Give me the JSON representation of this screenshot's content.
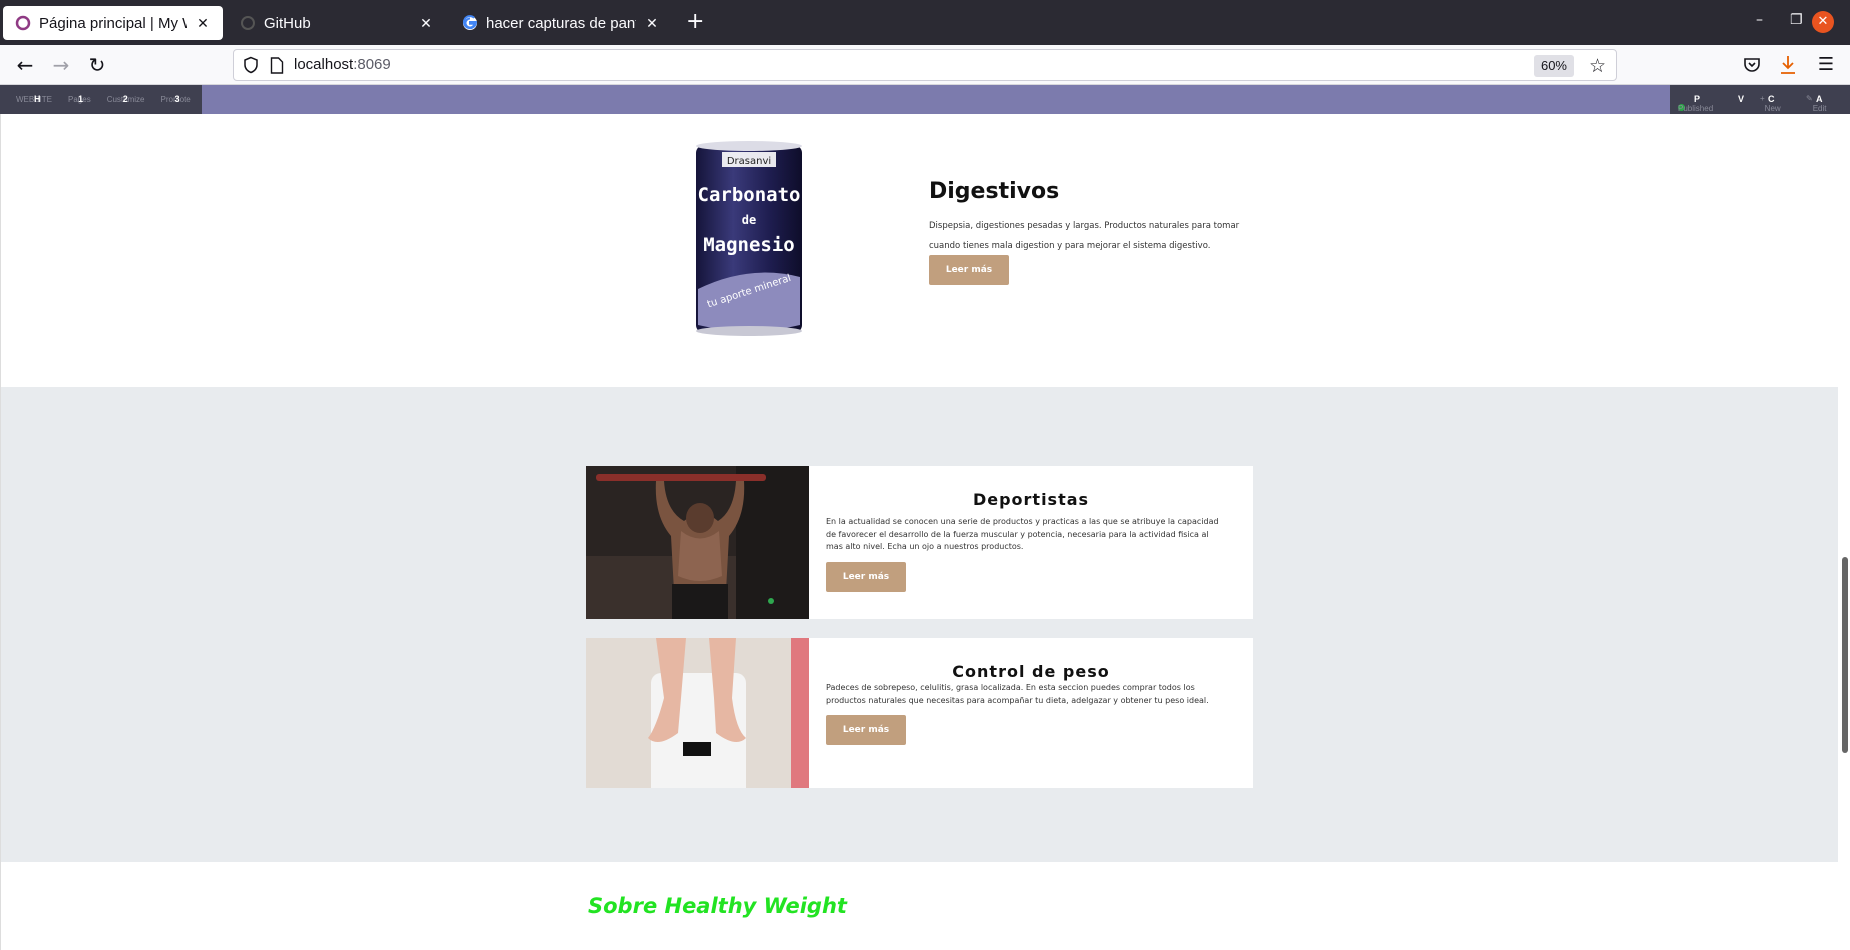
{
  "browser": {
    "tabs": [
      {
        "title": "Página principal | My Website",
        "active": true
      },
      {
        "title": "GitHub",
        "active": false
      },
      {
        "title": "hacer capturas de pantalla",
        "active": false
      }
    ],
    "url_host": "localhost",
    "url_port": ":8069",
    "zoom": "60%"
  },
  "odoo_bar": {
    "left_items": [
      {
        "label": "WEBSITE",
        "key": "H"
      },
      {
        "label": "Pages",
        "key": "1"
      },
      {
        "label": "Customize",
        "key": "2"
      },
      {
        "label": "Promote",
        "key": "3"
      }
    ],
    "right_items": [
      {
        "label": "Published",
        "key": "P"
      },
      {
        "label": "",
        "key": "V"
      },
      {
        "label": "New",
        "key": "C"
      },
      {
        "label": "Edit",
        "key": "A"
      }
    ]
  },
  "digestivos": {
    "can_brand": "Drasanvi",
    "can_line1": "Carbonato",
    "can_line2": "de",
    "can_line3": "Magnesio",
    "can_slogan": "tu aporte mineral",
    "title": "Digestivos",
    "text": "Dispepsia, digestiones pesadas y largas. Productos naturales para tomar cuando tienes mala digestion y para mejorar el sistema digestivo.",
    "button": "Leer más"
  },
  "cards": [
    {
      "title": "Deportistas",
      "text": "En la actualidad se conocen una serie de productos y practicas a las que se atribuye la capacidad de favorecer el desarrollo de la fuerza muscular y potencia, necesaria para la actividad fisica al mas alto nivel. Echa un ojo a nuestros productos.",
      "button": "Leer más"
    },
    {
      "title": "Control de peso",
      "text": "Padeces de sobrepeso, celulitis, grasa localizada. En esta seccion puedes comprar todos los productos naturales que necesitas para acompañar tu dieta, adelgazar y obtener tu peso ideal.",
      "button": "Leer más"
    }
  ],
  "sobre_title": "Sobre Healthy Weight",
  "colors": {
    "odoo_bar": "#7c7bad",
    "button": "#c19f7e",
    "section_gray": "#e8ebee",
    "sobre_green": "#22e322"
  }
}
